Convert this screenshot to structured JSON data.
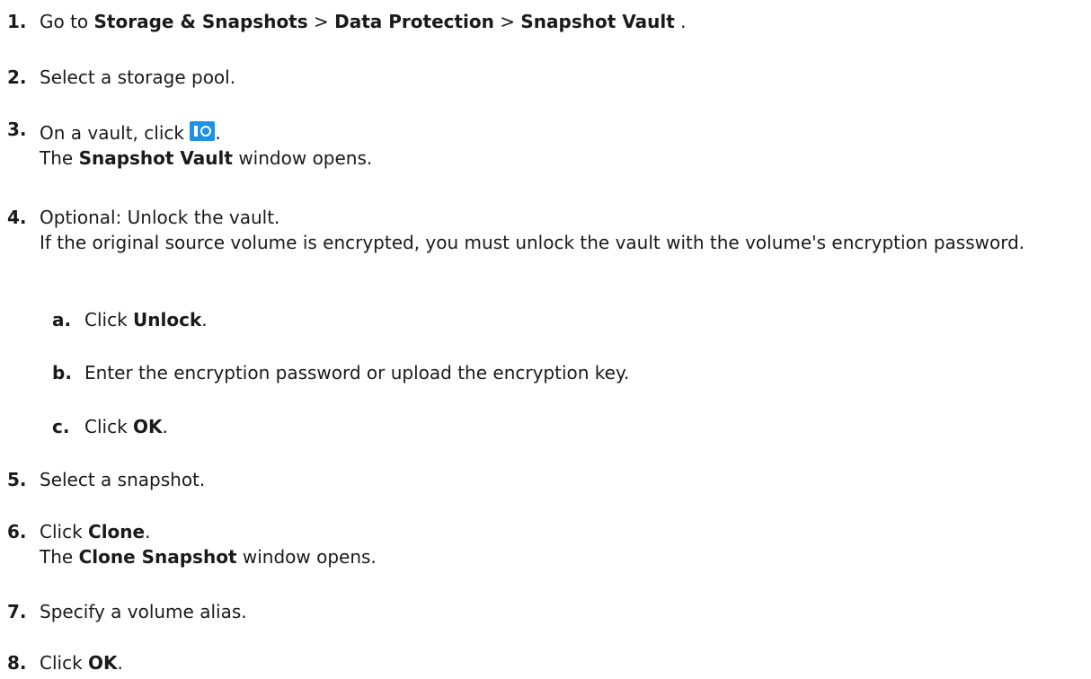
{
  "steps": [
    {
      "num": "1.",
      "parts": [
        "Go to ",
        "Storage & Snapshots",
        " > ",
        "Data Protection",
        " > ",
        "Snapshot Vault",
        " ."
      ]
    },
    {
      "num": "2.",
      "text": "Select a storage pool."
    },
    {
      "num": "3.",
      "pre": "On a vault, click ",
      "icon": "snapshot-vault-icon",
      "post": ".",
      "line2_bold": "Snapshot Vault",
      "line2_rest": " window opens.",
      "line2_pre": "The "
    },
    {
      "num": "4.",
      "text": "Optional: Unlock the vault.",
      "detail": "If the original source volume is encrypted, you must unlock the vault with the volume's encryption password.",
      "substeps": [
        {
          "num": "a.",
          "pre": "Click ",
          "bold": "Unlock",
          "post": "."
        },
        {
          "num": "b.",
          "text": "Enter the encryption password or upload the encryption key."
        },
        {
          "num": "c.",
          "pre": "Click ",
          "bold": "OK",
          "post": "."
        }
      ]
    },
    {
      "num": "5.",
      "text": "Select a snapshot."
    },
    {
      "num": "6.",
      "pre": "Click ",
      "bold": "Clone",
      "post": ".",
      "line2_pre": "The ",
      "line2_bold": "Clone Snapshot",
      "line2_rest": " window opens."
    },
    {
      "num": "7.",
      "text": "Specify a volume alias."
    },
    {
      "num": "8.",
      "pre": "Click ",
      "bold": "OK",
      "post": "."
    }
  ]
}
